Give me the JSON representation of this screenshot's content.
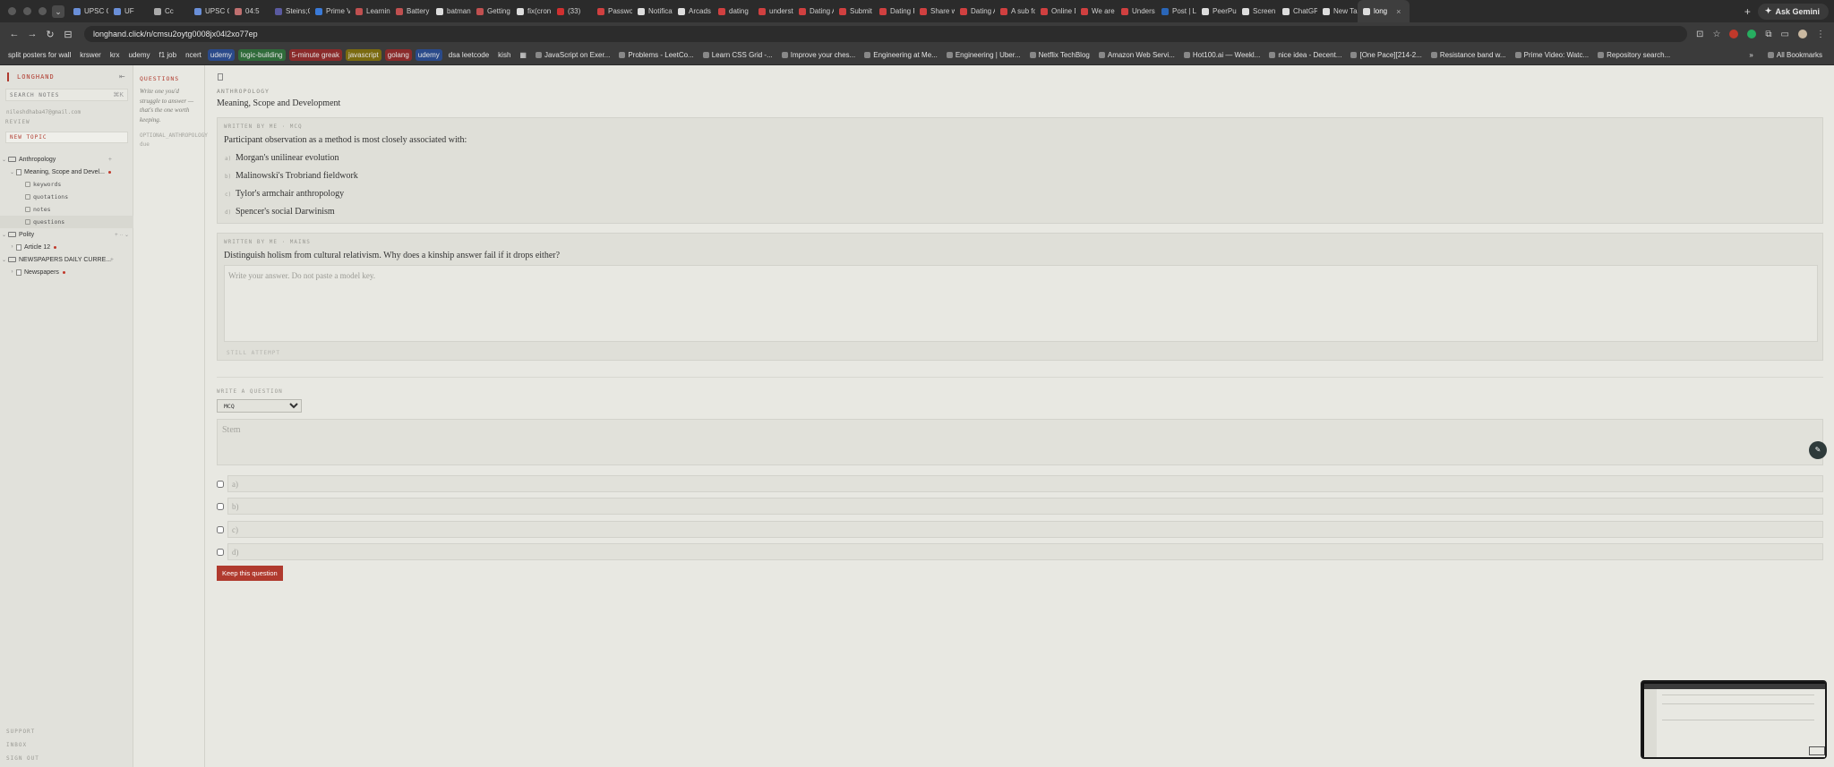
{
  "browser": {
    "tabs": [
      {
        "label": "UPSC CS",
        "color": "#6a8fd8"
      },
      {
        "label": "UF",
        "color": "#6a8fd8"
      },
      {
        "label": "Cc",
        "color": "#aaaaaa"
      },
      {
        "label": "UPSC CS",
        "color": "#6a8fd8"
      },
      {
        "label": "04:5",
        "color": "#c07070"
      },
      {
        "label": "Steins;G",
        "color": "#5a5aa0"
      },
      {
        "label": "Prime Vi",
        "color": "#3a7ad8"
      },
      {
        "label": "Learning",
        "color": "#c05050"
      },
      {
        "label": "Battery",
        "color": "#c05050"
      },
      {
        "label": "batman",
        "color": "#dddddd"
      },
      {
        "label": "Getting",
        "color": "#c05050"
      },
      {
        "label": "fix(cron",
        "color": "#dddddd"
      },
      {
        "label": "(33)",
        "color": "#d03030"
      },
      {
        "label": "Passwo",
        "color": "#d04040"
      },
      {
        "label": "Notificati",
        "color": "#dddddd"
      },
      {
        "label": "Arcads",
        "color": "#dddddd"
      },
      {
        "label": "dating",
        "color": "#d04040"
      },
      {
        "label": "underst",
        "color": "#d04040"
      },
      {
        "label": "Dating A",
        "color": "#d04040"
      },
      {
        "label": "Submit F",
        "color": "#d04040"
      },
      {
        "label": "Dating F",
        "color": "#d04040"
      },
      {
        "label": "Share w",
        "color": "#d04040"
      },
      {
        "label": "Dating A",
        "color": "#d04040"
      },
      {
        "label": "A sub fo",
        "color": "#d04040"
      },
      {
        "label": "Online D",
        "color": "#d04040"
      },
      {
        "label": "We are f",
        "color": "#d04040"
      },
      {
        "label": "Unders",
        "color": "#d04040"
      },
      {
        "label": "Post | Li",
        "color": "#2a66b8"
      },
      {
        "label": "PeerPul",
        "color": "#dddddd"
      },
      {
        "label": "Screen",
        "color": "#dddddd"
      },
      {
        "label": "ChatGP",
        "color": "#dddddd"
      },
      {
        "label": "New Tab",
        "color": "#dddddd"
      },
      {
        "label": "long",
        "color": "#dddddd",
        "active": true
      }
    ],
    "ask_gemini": "Ask Gemini",
    "url": "longhand.click/n/cmsu2oytg0008jx04l2xo77ep",
    "bookmarks": [
      {
        "label": "split posters for wall",
        "style": ""
      },
      {
        "label": "krswer",
        "style": ""
      },
      {
        "label": "krx",
        "style": ""
      },
      {
        "label": "udemy",
        "style": ""
      },
      {
        "label": "f1 job",
        "style": ""
      },
      {
        "label": "ncert",
        "style": ""
      },
      {
        "label": "udemy",
        "style": "tag-blue"
      },
      {
        "label": "logic-building",
        "style": "tag-green"
      },
      {
        "label": "5-minute greak",
        "style": "tag-red"
      },
      {
        "label": "javascript",
        "style": "tag-yellow"
      },
      {
        "label": "golang",
        "style": "tag-red"
      },
      {
        "label": "udemy",
        "style": "tag-blue"
      },
      {
        "label": "dsa leetcode",
        "style": ""
      },
      {
        "label": "kish",
        "style": ""
      },
      {
        "label": "JavaScript on Exer...",
        "style": ""
      },
      {
        "label": "Problems - LeetCo...",
        "style": ""
      },
      {
        "label": "Learn CSS Grid -...",
        "style": ""
      },
      {
        "label": "Improve your ches...",
        "style": ""
      },
      {
        "label": "Engineering at Me...",
        "style": ""
      },
      {
        "label": "Engineering | Uber...",
        "style": ""
      },
      {
        "label": "Netflix TechBlog",
        "style": ""
      },
      {
        "label": "Amazon Web Servi...",
        "style": ""
      },
      {
        "label": "Hot100.ai — Weekl...",
        "style": ""
      },
      {
        "label": "nice idea - Decent...",
        "style": ""
      },
      {
        "label": "[One Pace][214-2...",
        "style": ""
      },
      {
        "label": "Resistance band w...",
        "style": ""
      },
      {
        "label": "Prime Video: Watc...",
        "style": ""
      },
      {
        "label": "Repository search...",
        "style": ""
      }
    ],
    "all_bookmarks": "All Bookmarks"
  },
  "sidebar": {
    "brand": "LONGHAND",
    "search_placeholder": "SEARCH NOTES",
    "search_shortcut": "⌘K",
    "email": "nileshdhaba47@gmail.com",
    "review_label": "REVIEW",
    "new_topic_label": "NEW TOPIC",
    "tree": {
      "anthropology": "Anthropology",
      "meaning": "Meaning, Scope and Devel...",
      "keywords": "keywords",
      "quotations": "quotations",
      "notes": "notes",
      "questions": "questions",
      "polity": "Polity",
      "article12": "Article 12",
      "newspapers_folder": "NEWSPAPERS DAILY CURRE...",
      "newspapers": "Newspapers"
    },
    "footer": {
      "support": "SUPPORT",
      "inbox": "INBOX",
      "sign_out": "SIGN OUT"
    }
  },
  "questions_panel": {
    "label": "QUESTIONS",
    "hint": "Write one you'd struggle to answer — that's the one worth keeping.",
    "tag": "OPTIONAL_ANTHROPOLOGY",
    "due": "due"
  },
  "main": {
    "breadcrumb": "ANTHROPOLOGY",
    "title": "Meaning, Scope and Development",
    "mcq_card": {
      "meta": "WRITTEN BY ME · MCQ",
      "question": "Participant observation as a method is most closely associated with:",
      "options": [
        {
          "letter": "a)",
          "text": "Morgan's unilinear evolution"
        },
        {
          "letter": "b)",
          "text": "Malinowski's Trobriand fieldwork"
        },
        {
          "letter": "c)",
          "text": "Tylor's armchair anthropology"
        },
        {
          "letter": "d)",
          "text": "Spencer's social Darwinism"
        }
      ]
    },
    "mains_card": {
      "meta": "WRITTEN BY ME · MAINS",
      "question": "Distinguish holism from cultural relativism. Why does a kinship answer fail if it drops either?",
      "answer_placeholder": "Write your answer. Do not paste a model key.",
      "status": "STILL ATTEMPT"
    },
    "composer": {
      "label": "WRITE A QUESTION",
      "type_selected": "MCQ",
      "stem_placeholder": "Stem",
      "option_placeholders": [
        "a)",
        "b)",
        "c)",
        "d)"
      ],
      "submit_label": "Keep this question"
    }
  },
  "colors": {
    "accent": "#b03a2e",
    "background": "#e8e8e2",
    "sidebar": "#e1e1db"
  }
}
